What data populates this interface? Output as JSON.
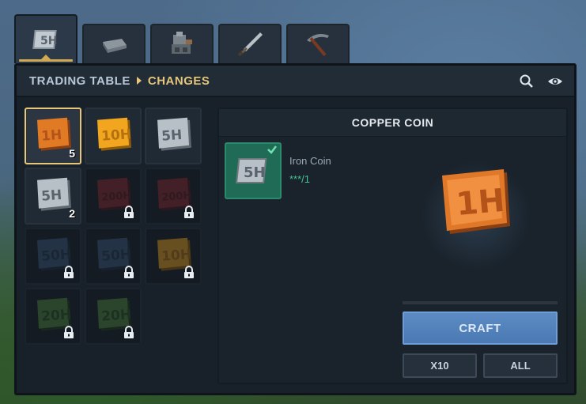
{
  "tabs": [
    {
      "id": "coins",
      "icon": "coin-5h-icon",
      "active": true
    },
    {
      "id": "ingots",
      "icon": "iron-ingot-icon",
      "active": false
    },
    {
      "id": "machines",
      "icon": "machine-icon",
      "active": false
    },
    {
      "id": "weapons",
      "icon": "sword-icon",
      "active": false
    },
    {
      "id": "tools",
      "icon": "pickaxe-icon",
      "active": false
    }
  ],
  "header": {
    "breadcrumb_root": "TRADING TABLE",
    "breadcrumb_current": "CHANGES"
  },
  "grid": [
    {
      "label": "1H",
      "color": "copper",
      "qty": "5",
      "locked": false,
      "selected": true
    },
    {
      "label": "10H",
      "color": "gold",
      "qty": "",
      "locked": false,
      "selected": false
    },
    {
      "label": "5H",
      "color": "silver",
      "qty": "",
      "locked": false,
      "selected": false
    },
    {
      "label": "5H",
      "color": "silver",
      "qty": "2",
      "locked": false,
      "selected": false
    },
    {
      "label": "200H",
      "color": "red",
      "qty": "",
      "locked": true,
      "selected": false
    },
    {
      "label": "200H",
      "color": "red",
      "qty": "",
      "locked": true,
      "selected": false
    },
    {
      "label": "50H",
      "color": "blue",
      "qty": "",
      "locked": true,
      "selected": false
    },
    {
      "label": "50H",
      "color": "blue",
      "qty": "",
      "locked": true,
      "selected": false
    },
    {
      "label": "10H",
      "color": "gold",
      "qty": "",
      "locked": true,
      "selected": false
    },
    {
      "label": "20H",
      "color": "green",
      "qty": "",
      "locked": true,
      "selected": false
    },
    {
      "label": "20H",
      "color": "green",
      "qty": "",
      "locked": true,
      "selected": false
    }
  ],
  "detail": {
    "title": "COPPER COIN",
    "ingredient_name": "Iron Coin",
    "ingredient_count": "***/1",
    "craft_label": "CRAFT",
    "x10_label": "X10",
    "all_label": "ALL"
  },
  "colors": {
    "copper": "#e07a25",
    "gold": "#f2a51e",
    "silver": "#a9b2ba",
    "red": "#a8323a",
    "blue": "#3d5a7e",
    "green": "#4f8a3a",
    "accent": "#e6c77a",
    "craft": "#4f7eb8"
  }
}
